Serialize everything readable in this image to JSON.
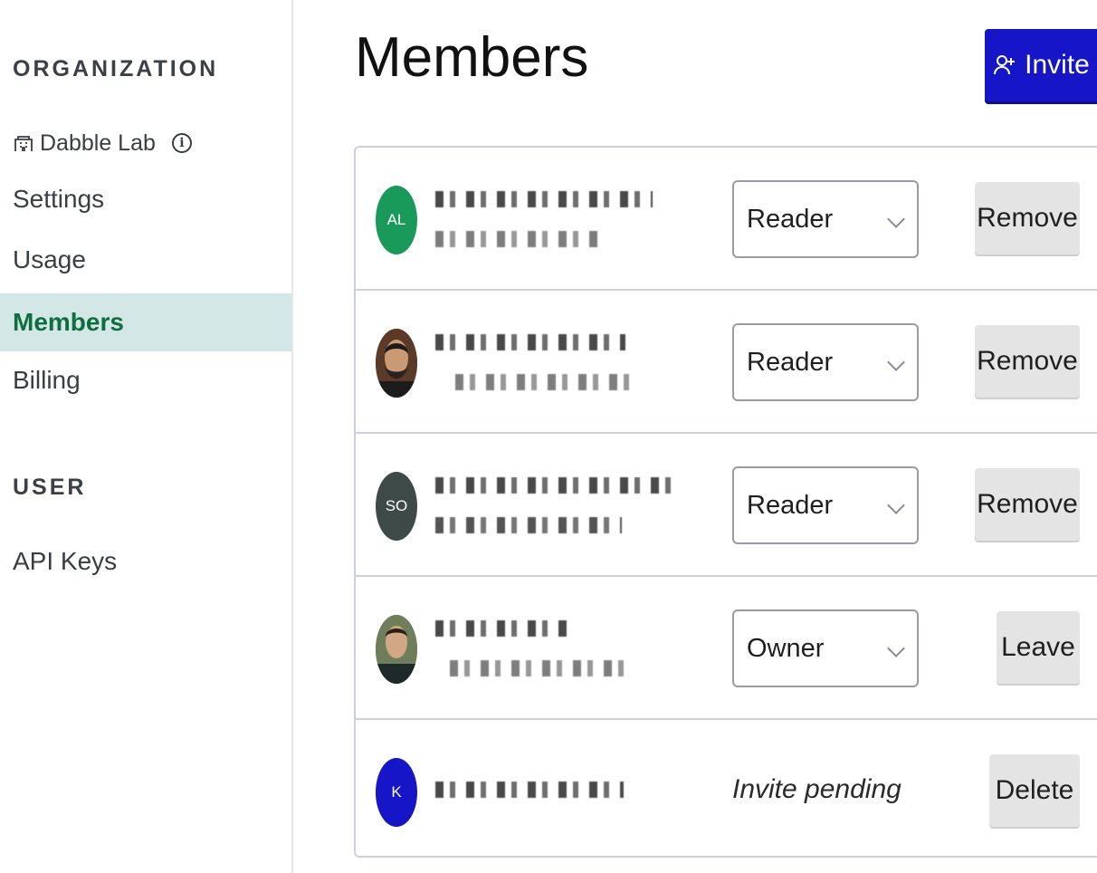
{
  "sidebar": {
    "organization_label": "ORGANIZATION",
    "org_name": "Dabble Lab",
    "org_items": [
      "Settings",
      "Usage",
      "Members",
      "Billing"
    ],
    "active_item": "Members",
    "user_label": "USER",
    "user_items": [
      "API Keys"
    ]
  },
  "header": {
    "title": "Members",
    "invite_label": "Invite"
  },
  "members": [
    {
      "avatar_initials": "AL",
      "avatar_color": "#1a9a5a",
      "role": "Reader",
      "action": "Remove"
    },
    {
      "avatar_initials": "",
      "avatar_color": "#6a4a36",
      "role": "Reader",
      "action": "Remove"
    },
    {
      "avatar_initials": "SO",
      "avatar_color": "#3d4a48",
      "role": "Reader",
      "action": "Remove"
    },
    {
      "avatar_initials": "",
      "avatar_color": "#5a6a4a",
      "role": "Owner",
      "action": "Leave"
    },
    {
      "avatar_initials": "K",
      "avatar_color": "#1616c8",
      "status": "Invite pending",
      "action": "Delete"
    }
  ],
  "icons": {
    "org": "building-icon",
    "info": "info-icon",
    "invite": "user-plus-icon",
    "select": "chevron-down-icon"
  },
  "colors": {
    "accent": "#1616c8",
    "active_bg": "#d3e8e6",
    "active_text": "#0e6e3e"
  }
}
